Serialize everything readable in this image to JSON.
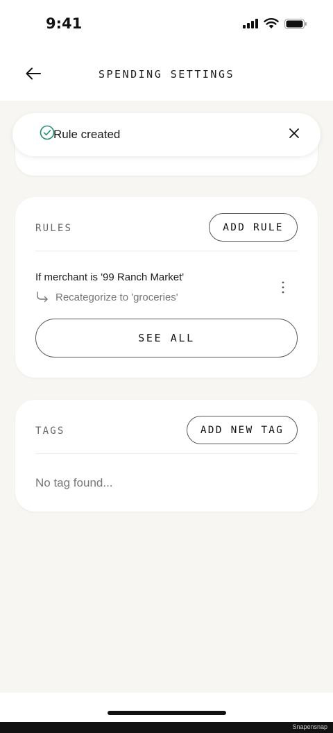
{
  "status_bar": {
    "time": "9:41"
  },
  "header": {
    "title": "SPENDING SETTINGS"
  },
  "toast": {
    "message": "Rule created"
  },
  "rules": {
    "label": "RULES",
    "add_button": "ADD RULE",
    "items": [
      {
        "condition": "If merchant is '99 Ranch Market'",
        "action": "Recategorize to 'groceries'"
      }
    ],
    "see_all": "SEE ALL"
  },
  "tags": {
    "label": "TAGS",
    "add_button": "ADD NEW TAG",
    "empty": "No tag found..."
  },
  "watermark": "Snapensnap",
  "colors": {
    "accent": "#1f8f6f",
    "background": "#f7f6f3",
    "card": "#ffffff"
  }
}
